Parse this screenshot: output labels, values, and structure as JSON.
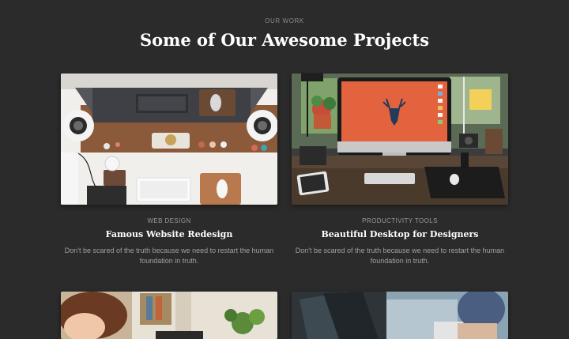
{
  "section": {
    "eyebrow": "OUR WORK",
    "title": "Some of Our Awesome Projects"
  },
  "projects": [
    {
      "category": "WEB DESIGN",
      "title": "Famous Website Redesign",
      "description": "Don't be scared of the truth because we need to restart the human foundation in truth."
    },
    {
      "category": "PRODUCTIVITY TOOLS",
      "title": "Beautiful Desktop for Designers",
      "description": "Don't be scared of the truth because we need to restart the human foundation in truth."
    }
  ],
  "colors": {
    "background": "#2b2b2b",
    "heading": "#ffffff",
    "muted": "#9a9a9a"
  }
}
